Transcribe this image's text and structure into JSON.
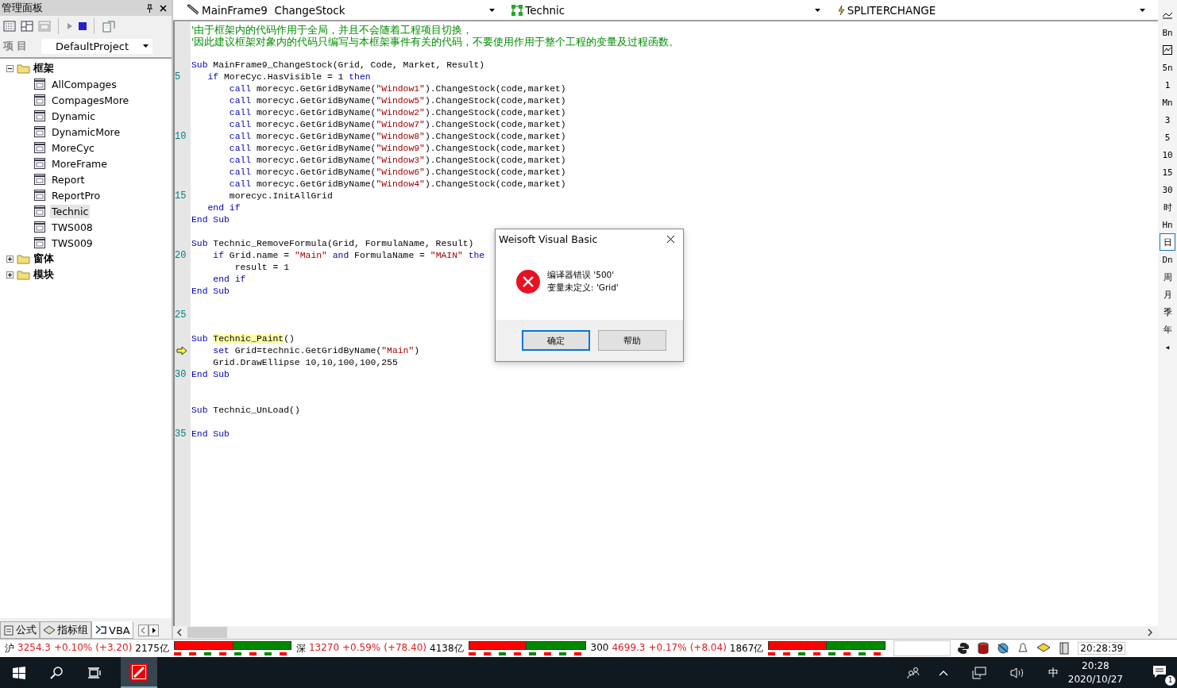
{
  "left_panel": {
    "title": "管理面板",
    "project_label": "项 目",
    "project": "DefaultProject",
    "tree": [
      {
        "label": "框架",
        "expanded": true,
        "children": [
          {
            "label": "AllCompages",
            "selected": false
          },
          {
            "label": "CompagesMore",
            "selected": false
          },
          {
            "label": "Dynamic",
            "selected": false
          },
          {
            "label": "DynamicMore",
            "selected": false
          },
          {
            "label": "MoreCyc",
            "selected": false
          },
          {
            "label": "MoreFrame",
            "selected": false
          },
          {
            "label": "Report",
            "selected": false
          },
          {
            "label": "ReportPro",
            "selected": false
          },
          {
            "label": "Technic",
            "selected": true
          },
          {
            "label": "TWS008",
            "selected": false
          },
          {
            "label": "TWS009",
            "selected": false
          }
        ]
      },
      {
        "label": "窗体",
        "expanded": false
      },
      {
        "label": "模块",
        "expanded": false
      }
    ],
    "tabs": [
      {
        "label": "公式",
        "selected": false
      },
      {
        "label": "指标组",
        "selected": false
      },
      {
        "label": "VBA",
        "selected": true
      }
    ]
  },
  "editor": {
    "combos": [
      "MainFrame9  ChangeStock",
      "Technic",
      "SPLITERCHANGE"
    ],
    "lines": [
      {
        "current": false,
        "tokens": [
          {
            "kind": "comment",
            "text": "'由于框架内的代码作用于全局，并且不会随着工程项目切换，"
          }
        ]
      },
      {
        "current": false,
        "tokens": [
          {
            "kind": "comment",
            "text": "'因此建议框架对象内的代码只编写与本框架事件有关的代码，不要使用作用于整个工程的变量及过程函数。"
          }
        ]
      },
      {
        "current": false
      },
      {
        "current": false,
        "tokens": [
          {
            "kind": "keyword",
            "text": "Sub"
          },
          {
            "kind": "plain",
            "text": " MainFrame9_ChangeStock(Grid, Code, Market, Result)"
          }
        ]
      },
      {
        "current": false,
        "number": "5",
        "tokens": [
          {
            "kind": "keyword",
            "text": "   if"
          },
          {
            "kind": "plain",
            "text": " MoreCyc.HasVisible = 1 "
          },
          {
            "kind": "keyword",
            "text": "then"
          }
        ]
      },
      {
        "current": false,
        "tokens": [
          {
            "kind": "keyword",
            "text": "       call"
          },
          {
            "kind": "plain",
            "text": " morecyc.GetGridByName("
          },
          {
            "kind": "string",
            "text": "\"Window1\""
          },
          {
            "kind": "plain",
            "text": ").ChangeStock(code,market)"
          }
        ]
      },
      {
        "current": false,
        "tokens": [
          {
            "kind": "keyword",
            "text": "       call"
          },
          {
            "kind": "plain",
            "text": " morecyc.GetGridByName("
          },
          {
            "kind": "string",
            "text": "\"Window5\""
          },
          {
            "kind": "plain",
            "text": ").ChangeStock(code,market)"
          }
        ]
      },
      {
        "current": false,
        "tokens": [
          {
            "kind": "keyword",
            "text": "       call"
          },
          {
            "kind": "plain",
            "text": " morecyc.GetGridByName("
          },
          {
            "kind": "string",
            "text": "\"Window2\""
          },
          {
            "kind": "plain",
            "text": ").ChangeStock(code,market)"
          }
        ]
      },
      {
        "current": false,
        "tokens": [
          {
            "kind": "keyword",
            "text": "       call"
          },
          {
            "kind": "plain",
            "text": " morecyc.GetGridByName("
          },
          {
            "kind": "string",
            "text": "\"Window7\""
          },
          {
            "kind": "plain",
            "text": ").ChangeStock(code,market)"
          }
        ]
      },
      {
        "current": false,
        "number": "10",
        "tokens": [
          {
            "kind": "keyword",
            "text": "       call"
          },
          {
            "kind": "plain",
            "text": " morecyc.GetGridByName("
          },
          {
            "kind": "string",
            "text": "\"Window8\""
          },
          {
            "kind": "plain",
            "text": ").ChangeStock(code,market)"
          }
        ]
      },
      {
        "current": false,
        "tokens": [
          {
            "kind": "keyword",
            "text": "       call"
          },
          {
            "kind": "plain",
            "text": " morecyc.GetGridByName("
          },
          {
            "kind": "string",
            "text": "\"Window9\""
          },
          {
            "kind": "plain",
            "text": ").ChangeStock(code,market)"
          }
        ]
      },
      {
        "current": false,
        "tokens": [
          {
            "kind": "keyword",
            "text": "       call"
          },
          {
            "kind": "plain",
            "text": " morecyc.GetGridByName("
          },
          {
            "kind": "string",
            "text": "\"Window3\""
          },
          {
            "kind": "plain",
            "text": ").ChangeStock(code,market)"
          }
        ]
      },
      {
        "current": false,
        "tokens": [
          {
            "kind": "keyword",
            "text": "       call"
          },
          {
            "kind": "plain",
            "text": " morecyc.GetGridByName("
          },
          {
            "kind": "string",
            "text": "\"Window6\""
          },
          {
            "kind": "plain",
            "text": ").ChangeStock(code,market)"
          }
        ]
      },
      {
        "current": false,
        "tokens": [
          {
            "kind": "keyword",
            "text": "       call"
          },
          {
            "kind": "plain",
            "text": " morecyc.GetGridByName("
          },
          {
            "kind": "string",
            "text": "\"Window4\""
          },
          {
            "kind": "plain",
            "text": ").ChangeStock(code,market)"
          }
        ]
      },
      {
        "current": false,
        "number": "15",
        "tokens": [
          {
            "kind": "plain",
            "text": "       morecyc.InitAllGrid"
          }
        ]
      },
      {
        "current": false,
        "tokens": [
          {
            "kind": "keyword",
            "text": "   end if"
          }
        ]
      },
      {
        "current": false,
        "tokens": [
          {
            "kind": "keyword",
            "text": "End Sub"
          }
        ]
      },
      {
        "current": false
      },
      {
        "current": false,
        "tokens": [
          {
            "kind": "keyword",
            "text": "Sub"
          },
          {
            "kind": "plain",
            "text": " Technic_RemoveFormula(Grid, FormulaName, Result)"
          }
        ]
      },
      {
        "current": false,
        "number": "20",
        "tokens": [
          {
            "kind": "keyword",
            "text": "    if"
          },
          {
            "kind": "plain",
            "text": " Grid.name = "
          },
          {
            "kind": "string",
            "text": "\"Main\""
          },
          {
            "kind": "keyword",
            "text": " and"
          },
          {
            "kind": "plain",
            "text": " FormulaName = "
          },
          {
            "kind": "string",
            "text": "\"MAIN\""
          },
          {
            "kind": "keyword",
            "text": " the"
          }
        ]
      },
      {
        "current": false,
        "tokens": [
          {
            "kind": "plain",
            "text": "        result = 1"
          }
        ]
      },
      {
        "current": false,
        "tokens": [
          {
            "kind": "keyword",
            "text": "    end if"
          }
        ]
      },
      {
        "current": false,
        "tokens": [
          {
            "kind": "keyword",
            "text": "End Sub"
          }
        ]
      },
      {
        "current": false
      },
      {
        "current": false,
        "number": "25"
      },
      {
        "current": false
      },
      {
        "current": false,
        "tokens": [
          {
            "kind": "keyword",
            "text": "Sub "
          },
          {
            "kind": "highlight",
            "text": "Technic_Paint"
          },
          {
            "kind": "plain",
            "text": "()"
          }
        ]
      },
      {
        "current": true,
        "tokens": [
          {
            "kind": "keyword",
            "text": "    set"
          },
          {
            "kind": "plain",
            "text": " Grid=technic.GetGridByName("
          },
          {
            "kind": "string",
            "text": "\"Main\""
          },
          {
            "kind": "plain",
            "text": ")"
          }
        ]
      },
      {
        "current": false,
        "tokens": [
          {
            "kind": "plain",
            "text": "    Grid.DrawEllipse 10,10,100,100,255"
          }
        ]
      },
      {
        "current": false,
        "number": "30",
        "tokens": [
          {
            "kind": "keyword",
            "text": "End Sub"
          }
        ]
      },
      {
        "current": false
      },
      {
        "current": false
      },
      {
        "current": false,
        "tokens": [
          {
            "kind": "keyword",
            "text": "Sub"
          },
          {
            "kind": "plain",
            "text": " Technic_UnLoad()"
          }
        ]
      },
      {
        "current": false
      },
      {
        "current": false,
        "number": "35",
        "tokens": [
          {
            "kind": "keyword",
            "text": "End Sub"
          }
        ]
      }
    ]
  },
  "dialog": {
    "title": "Weisoft Visual Basic",
    "message": [
      "编译器错误 '500'",
      "变量未定义: 'Grid'"
    ],
    "buttons": [
      {
        "label": "确定",
        "default": true
      },
      {
        "label": "帮助",
        "default": false
      }
    ]
  },
  "period_bar": [
    {
      "kind": "trend",
      "selected": false
    },
    {
      "kind": "text",
      "label": "Bn",
      "selected": false
    },
    {
      "kind": "framed-trend",
      "selected": false
    },
    {
      "kind": "text",
      "label": "5n",
      "selected": false
    },
    {
      "kind": "text",
      "label": "1",
      "selected": false
    },
    {
      "kind": "text",
      "label": "Mn",
      "selected": false
    },
    {
      "kind": "text",
      "label": "3",
      "selected": false
    },
    {
      "kind": "text",
      "label": "5",
      "selected": false
    },
    {
      "kind": "text",
      "label": "10",
      "selected": false
    },
    {
      "kind": "text",
      "label": "15",
      "selected": false
    },
    {
      "kind": "text",
      "label": "30",
      "selected": false
    },
    {
      "kind": "text",
      "label": "时",
      "selected": false
    },
    {
      "kind": "text",
      "label": "Hn",
      "selected": false
    },
    {
      "kind": "text",
      "label": "日",
      "selected": true
    },
    {
      "kind": "text",
      "label": "Dn",
      "selected": false
    },
    {
      "kind": "text",
      "label": "周",
      "selected": false
    },
    {
      "kind": "text",
      "label": "月",
      "selected": false
    },
    {
      "kind": "text",
      "label": "季",
      "selected": false
    },
    {
      "kind": "text",
      "label": "年",
      "selected": false
    },
    {
      "kind": "text",
      "label": "◂",
      "selected": false
    }
  ],
  "status_bar": {
    "indices": [
      {
        "name": "沪",
        "value": "3254.3",
        "change_pct": "+0.10%",
        "change": "(+3.20)",
        "volume": "2175亿",
        "level": 0.5
      },
      {
        "name": "深",
        "value": "13270",
        "change_pct": "+0.59%",
        "change": "(+78.40)",
        "volume": "4138亿",
        "level": 0.49
      },
      {
        "name": "300",
        "value": "4699.3",
        "change_pct": "+0.17%",
        "change": "(+8.04)",
        "volume": "1867亿",
        "level": 0.49
      }
    ],
    "clock": "20:28:39"
  },
  "taskbar": {
    "time": "20:28",
    "date": "2020/10/27",
    "ime": "中",
    "notifications": "1"
  }
}
